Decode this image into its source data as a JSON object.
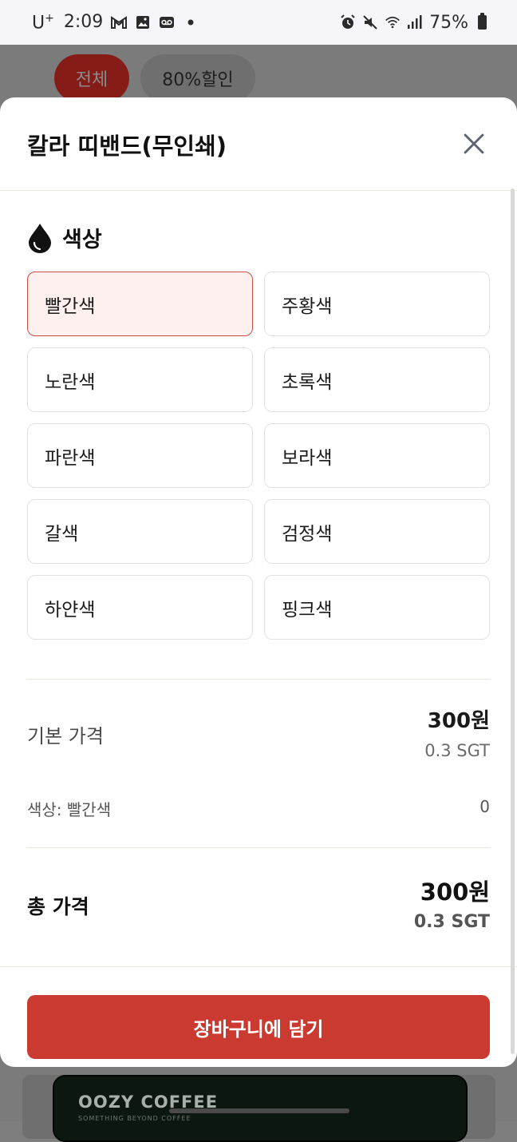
{
  "status_bar": {
    "carrier": "U",
    "carrier_sup": "+",
    "time": "2:09",
    "battery": "75%",
    "icons": [
      "gmail-icon",
      "gallery-icon",
      "voicemail-icon",
      "dot-icon",
      "alarm-icon",
      "mute-icon",
      "wifi-icon",
      "signal-icon",
      "battery-icon"
    ]
  },
  "background": {
    "chips": [
      "전체",
      "80%할인"
    ],
    "card_title": "OOZY COFFEE",
    "card_subtitle": "SOMETHING BEYOND COFFEE"
  },
  "sheet": {
    "title": "칼라 띠밴드(무인쇄)",
    "close_icon": "close-icon",
    "section_title": "색상",
    "section_icon": "drop-icon",
    "options": [
      "빨간색",
      "주황색",
      "노란색",
      "초록색",
      "파란색",
      "보라색",
      "갈색",
      "검정색",
      "하얀색",
      "핑크색"
    ],
    "selected_option": "빨간색",
    "base_price_label": "기본 가격",
    "base_price_krw": "300원",
    "base_price_sgt": "0.3 SGT",
    "option_line_label": "색상: 빨간색",
    "option_line_value": "0",
    "total_label": "총 가격",
    "total_krw": "300원",
    "total_sgt": "0.3 SGT",
    "cta_label": "장바구니에 담기"
  },
  "colors": {
    "accent": "#cb3a30",
    "selected_bg": "#fdf0ee",
    "selected_border": "#cf4c43"
  }
}
